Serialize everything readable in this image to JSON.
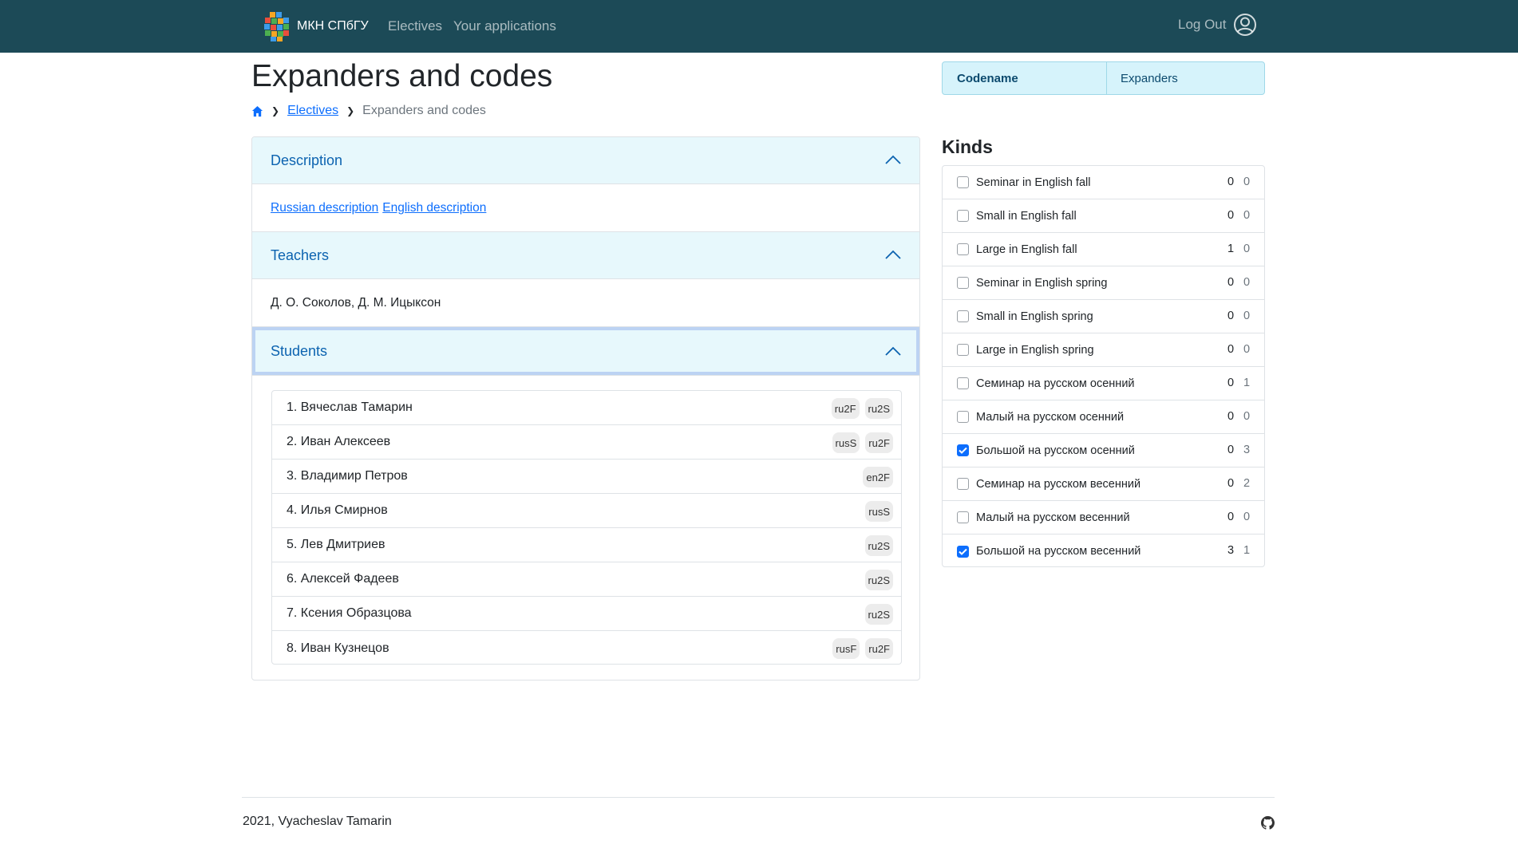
{
  "navbar": {
    "brand": "МКН СПбГУ",
    "links": [
      "Electives",
      "Your applications"
    ],
    "logout": "Log Out",
    "brand_colors": [
      "#e94e3c",
      "#f5a623",
      "#3d9be9",
      "#4caf50"
    ]
  },
  "page": {
    "title": "Expanders and codes",
    "breadcrumb": {
      "link": "Electives",
      "current": "Expanders and codes"
    }
  },
  "sections": {
    "description": {
      "title": "Description",
      "links": [
        "Russian description",
        "English description"
      ]
    },
    "teachers": {
      "title": "Teachers",
      "text": "Д. О. Соколов, Д. М. Ицыксон"
    },
    "students": {
      "title": "Students",
      "rows": [
        {
          "name": "1. Вячеслав Тамарин",
          "badges": [
            "ru2F",
            "ru2S"
          ]
        },
        {
          "name": "2. Иван Алексеев",
          "badges": [
            "rusS",
            "ru2F"
          ]
        },
        {
          "name": "3. Владимир Петров",
          "badges": [
            "en2F"
          ]
        },
        {
          "name": "4. Илья Смирнов",
          "badges": [
            "rusS"
          ]
        },
        {
          "name": "5. Лев Дмитриев",
          "badges": [
            "ru2S"
          ]
        },
        {
          "name": "6. Алексей Фадеев",
          "badges": [
            "ru2S"
          ]
        },
        {
          "name": "7. Ксения Образцова",
          "badges": [
            "ru2S"
          ]
        },
        {
          "name": "8. Иван Кузнецов",
          "badges": [
            "rusF",
            "ru2F"
          ]
        }
      ]
    }
  },
  "codename": {
    "label": "Codename",
    "value": "Expanders"
  },
  "kinds": {
    "title": "Kinds",
    "rows": [
      {
        "label": "Seminar in English fall",
        "a": "0",
        "b": "0",
        "checked": false
      },
      {
        "label": "Small in English fall",
        "a": "0",
        "b": "0",
        "checked": false
      },
      {
        "label": "Large in English fall",
        "a": "1",
        "b": "0",
        "checked": false
      },
      {
        "label": "Seminar in English spring",
        "a": "0",
        "b": "0",
        "checked": false
      },
      {
        "label": "Small in English spring",
        "a": "0",
        "b": "0",
        "checked": false
      },
      {
        "label": "Large in English spring",
        "a": "0",
        "b": "0",
        "checked": false
      },
      {
        "label": "Семинар на русском осенний",
        "a": "0",
        "b": "1",
        "checked": false
      },
      {
        "label": "Малый на русском осенний",
        "a": "0",
        "b": "0",
        "checked": false
      },
      {
        "label": "Большой на русском осенний",
        "a": "0",
        "b": "3",
        "checked": true
      },
      {
        "label": "Семинар на русском весенний",
        "a": "0",
        "b": "2",
        "checked": false
      },
      {
        "label": "Малый на русском весенний",
        "a": "0",
        "b": "0",
        "checked": false
      },
      {
        "label": "Большой на русском весенний",
        "a": "3",
        "b": "1",
        "checked": true
      }
    ]
  },
  "footer": {
    "text": "2021, Vyacheslav Tamarin"
  }
}
